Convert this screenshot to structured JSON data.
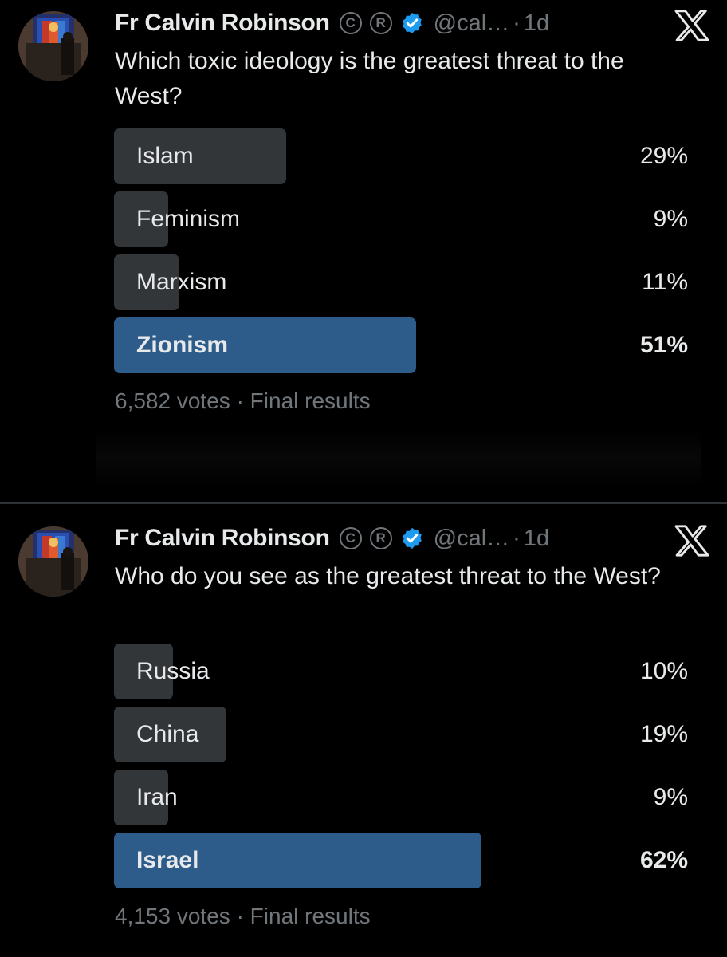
{
  "posts": [
    {
      "author": "Fr Calvin Robinson",
      "badge_c": "C",
      "badge_r": "R",
      "handle": "@cal…",
      "separator": "·",
      "time": "1d",
      "question": "Which toxic ideology is the greatest threat to the West?",
      "options": [
        {
          "label": "Islam",
          "percent": "29%",
          "value": 29,
          "winner": false
        },
        {
          "label": "Feminism",
          "percent": "9%",
          "value": 9,
          "winner": false
        },
        {
          "label": "Marxism",
          "percent": "11%",
          "value": 11,
          "winner": false
        },
        {
          "label": "Zionism",
          "percent": "51%",
          "value": 51,
          "winner": true
        }
      ],
      "votes": "6,582 votes",
      "status": "Final results"
    },
    {
      "author": "Fr Calvin Robinson",
      "badge_c": "C",
      "badge_r": "R",
      "handle": "@cal…",
      "separator": "·",
      "time": "1d",
      "question": "Who do you see as the greatest threat to the West?",
      "options": [
        {
          "label": "Russia",
          "percent": "10%",
          "value": 10,
          "winner": false
        },
        {
          "label": "China",
          "percent": "19%",
          "value": 19,
          "winner": false
        },
        {
          "label": "Iran",
          "percent": "9%",
          "value": 9,
          "winner": false
        },
        {
          "label": "Israel",
          "percent": "62%",
          "value": 62,
          "winner": true
        }
      ],
      "votes": "4,153 votes",
      "status": "Final results"
    }
  ],
  "colors": {
    "background": "#000000",
    "text": "#e7e9ea",
    "muted": "#71767b",
    "bar": "#333639",
    "winner_bar": "#2e5c8a",
    "verified": "#1d9bf0"
  },
  "icons": {
    "verified": "verified-badge-icon",
    "brand": "x-logo-icon"
  }
}
